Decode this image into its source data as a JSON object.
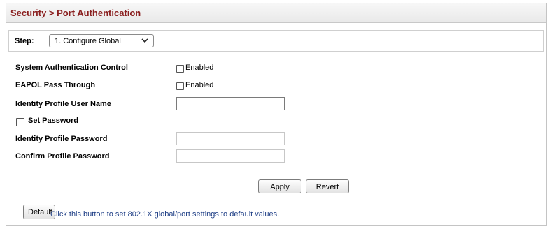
{
  "breadcrumb": "Security > Port Authentication",
  "step": {
    "label": "Step:",
    "selected": "1. Configure Global"
  },
  "fields": {
    "system_auth_control": {
      "label": "System Authentication Control",
      "checkbox_label": "Enabled"
    },
    "eapol_pass_through": {
      "label": "EAPOL Pass Through",
      "checkbox_label": "Enabled"
    },
    "identity_user_name": {
      "label": "Identity Profile User Name",
      "value": ""
    },
    "set_password": {
      "label": "Set Password"
    },
    "identity_password": {
      "label": "Identity Profile Password",
      "value": ""
    },
    "confirm_password": {
      "label": "Confirm Profile Password",
      "value": ""
    }
  },
  "buttons": {
    "apply": "Apply",
    "revert": "Revert",
    "default": "Default"
  },
  "default_hint": "Click this button to set 802.1X global/port settings to default values.",
  "colors": {
    "title": "#8a1f1f",
    "hint": "#1f3f86"
  },
  "icons": {
    "select_arrow": "chevron-down-icon"
  }
}
